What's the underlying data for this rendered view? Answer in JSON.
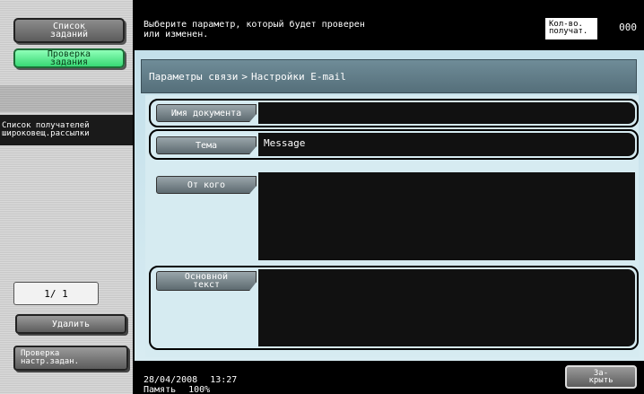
{
  "sidebar": {
    "job_list_line1": "Список",
    "job_list_line2": "заданий",
    "job_check_line1": "Проверка",
    "job_check_line2": "задания",
    "broadcast_heading_line1": "Список получателей",
    "broadcast_heading_line2": "широковещ.рассылки",
    "page_indicator": "1/ 1",
    "delete_label": "Удалить",
    "job_settings_line1": "Проверка",
    "job_settings_line2": "настр.задан."
  },
  "header": {
    "message_line1": "Выберите параметр, который будет проверен",
    "message_line2": "или изменен.",
    "qty_label_line1": "Кол-во.",
    "qty_label_line2": "получат.",
    "qty_value": "000"
  },
  "breadcrumb": {
    "parent": "Параметры связи",
    "separator": ">",
    "current": "Настройки E-mail"
  },
  "fields": {
    "document_name": {
      "label": "Имя документа",
      "value": ""
    },
    "subject": {
      "label": "Тема",
      "value": "Message"
    },
    "from": {
      "label": "От кого",
      "value": ""
    },
    "body": {
      "label_line1": "Основной",
      "label_line2": "текст",
      "value": ""
    }
  },
  "footer": {
    "date": "28/04/2008",
    "time": "13:27",
    "memory_label": "Память",
    "memory_value": "100%",
    "close_line1": "За-",
    "close_line2": "крыть"
  }
}
